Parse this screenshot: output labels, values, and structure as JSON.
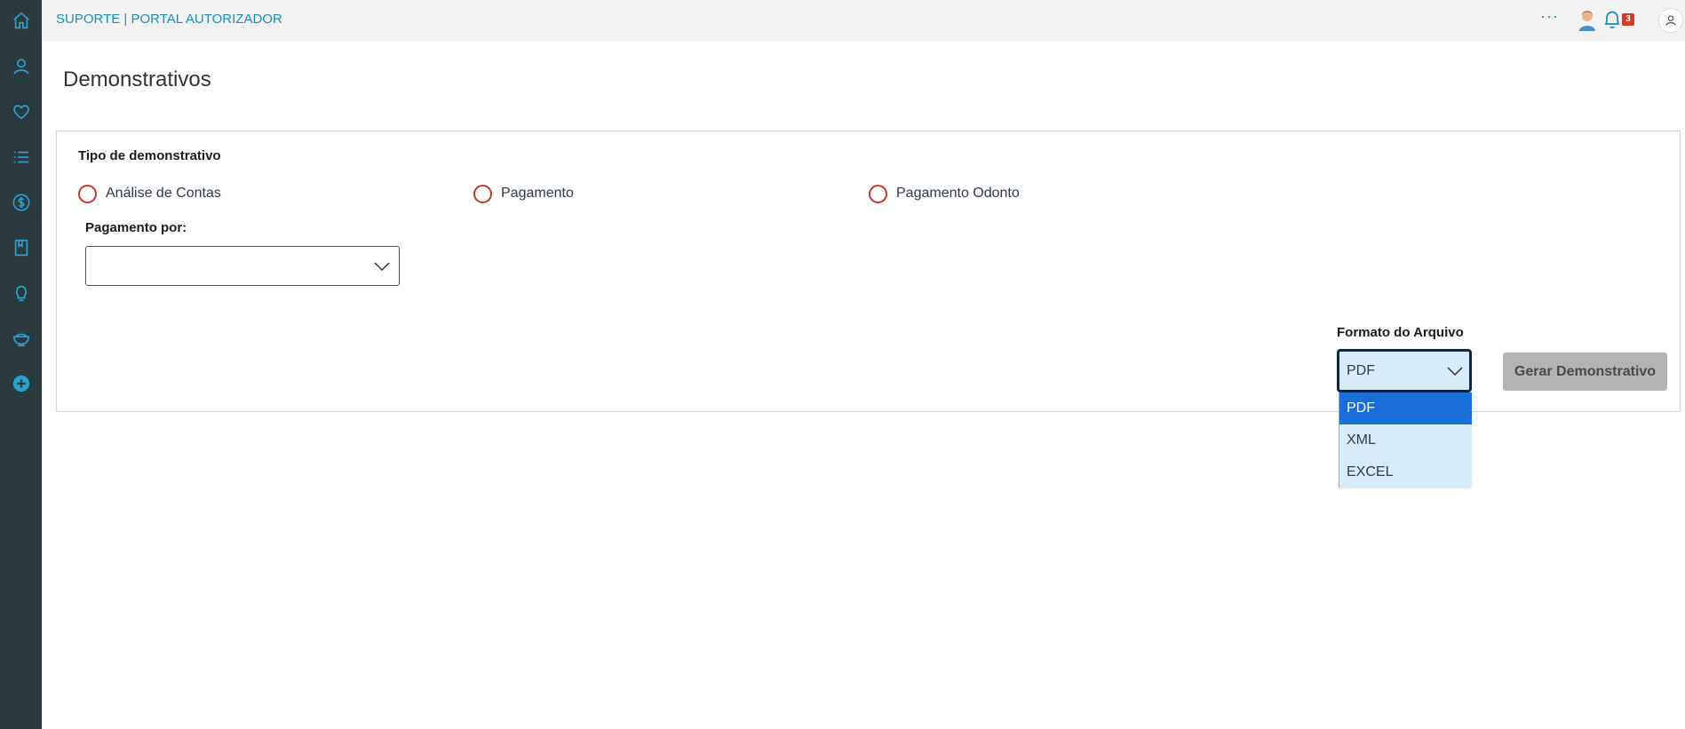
{
  "app": {
    "title": "SUPORTE | PORTAL AUTORIZADOR"
  },
  "sidebar": {
    "items": [
      {
        "icon": "home-icon"
      },
      {
        "icon": "user-icon"
      },
      {
        "icon": "heart-icon"
      },
      {
        "icon": "list-icon"
      },
      {
        "icon": "dollar-icon"
      },
      {
        "icon": "book-icon"
      },
      {
        "icon": "lightbulb-icon"
      },
      {
        "icon": "plate-icon"
      },
      {
        "icon": "add-icon"
      }
    ]
  },
  "topbar": {
    "more": "···",
    "notifications_count": "3"
  },
  "page": {
    "title": "Demonstrativos"
  },
  "form": {
    "tipo_label": "Tipo de demonstrativo",
    "radios": [
      "Análise de Contas",
      "Pagamento",
      "Pagamento Odonto"
    ],
    "pagamento_por_label": "Pagamento por:",
    "pagamento_por_value": "",
    "formato_label": "Formato do Arquivo",
    "formato_value": "PDF",
    "formato_options": [
      "PDF",
      "XML",
      "EXCEL"
    ],
    "generate_label": "Gerar Demonstrativo"
  },
  "colors": {
    "accent": "#1b8fb8",
    "sidebar_bg": "#2b3a3f",
    "radio_border": "#c0392b",
    "dropdown_bg": "#d7ecf9",
    "selected_option": "#1a6ed8",
    "badge": "#d33a2c"
  }
}
